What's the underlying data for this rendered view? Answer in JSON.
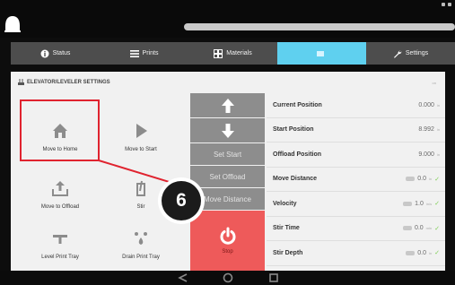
{
  "tabs": [
    {
      "label": "Status",
      "icon": "info-icon",
      "active": false
    },
    {
      "label": "Prints",
      "icon": "list-icon",
      "active": false
    },
    {
      "label": "Materials",
      "icon": "grid-icon",
      "active": false
    },
    {
      "label": "",
      "icon": "manual-icon",
      "active": true
    },
    {
      "label": "Settings",
      "icon": "wrench-icon",
      "active": false
    }
  ],
  "panel": {
    "title": "ELEVATOR/LEVELER SETTINGS",
    "corner_label": "on"
  },
  "tiles": {
    "move_to_home": "Move to Home",
    "move_to_start": "Move to Start",
    "move_to_offload": "Move to Offload",
    "stir": "Stir",
    "level_print_tray": "Level Print Tray",
    "drain_print_tray": "Drain Print Tray"
  },
  "motion": {
    "set_start": "Set Start",
    "set_offload": "Set Offload",
    "move_distance": "Move Distance",
    "stop": "Stop"
  },
  "params": [
    {
      "label": "Current Position",
      "value": "0.000",
      "unit": "in"
    },
    {
      "label": "Start Position",
      "value": "8.992",
      "unit": "in"
    },
    {
      "label": "Offload Position",
      "value": "9.000",
      "unit": "in"
    },
    {
      "label": "Move Distance",
      "value": "0.0",
      "unit": "in"
    },
    {
      "label": "Velocity",
      "value": "1.0",
      "unit": "in/s"
    },
    {
      "label": "Stir Time",
      "value": "0.0",
      "unit": "min"
    },
    {
      "label": "Stir Depth",
      "value": "0.0",
      "unit": "in"
    }
  ],
  "callout": {
    "number": "6"
  },
  "colors": {
    "accent": "#5fd0ef",
    "highlight": "#e0232f",
    "stop": "#ee5a5a",
    "confirm": "#7dcf53"
  }
}
